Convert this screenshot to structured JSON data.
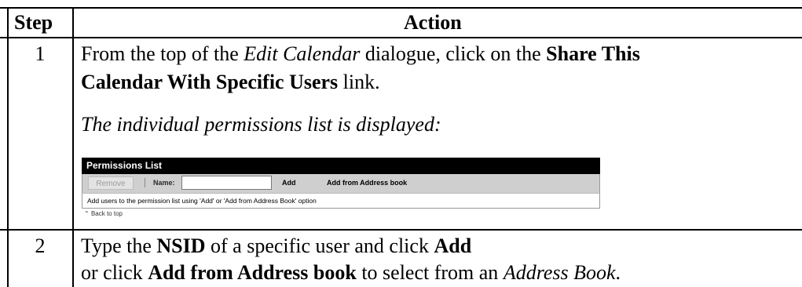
{
  "table": {
    "headers": {
      "step": "Step",
      "action": "Action"
    },
    "rows": [
      {
        "step": "1",
        "line1": {
          "a": "From the top of the ",
          "b": "Edit Calendar",
          "c": " dialogue, click on the ",
          "d": "Share This"
        },
        "line2": {
          "a": "Calendar With Specific Users",
          "b": " link."
        },
        "result": "The individual permissions list is displayed:"
      },
      {
        "step": "2",
        "line1": {
          "a": "Type the ",
          "b": "NSID",
          "c": " of a specific user and click ",
          "d": "Add"
        },
        "line2": {
          "a": "or click ",
          "b": "Add from Address book",
          "c": " to select from an ",
          "d": "Address Book",
          "e": "."
        }
      }
    ]
  },
  "permissions_list": {
    "title": "Permissions List",
    "remove_label": "Remove",
    "name_label": "Name:",
    "name_value": "",
    "add_label": "Add",
    "add_from_address_book_label": "Add from Address book",
    "help_text": "Add users to the permission list using 'Add' or 'Add from Address Book' option",
    "back_to_top": "« Back to top",
    "back_to_top_text": "Back to top"
  }
}
